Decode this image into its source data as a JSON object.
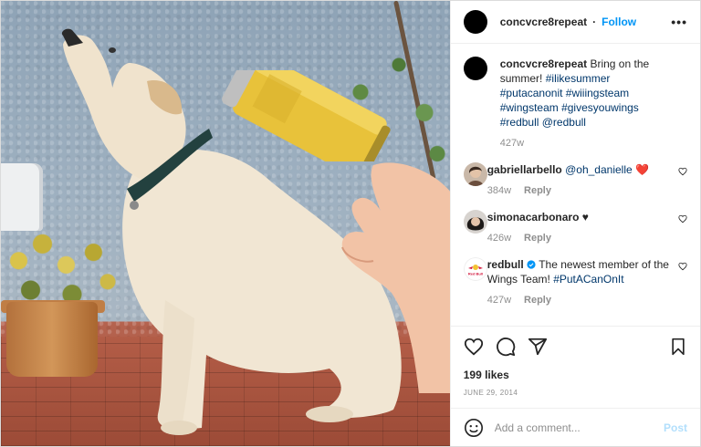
{
  "post": {
    "username": "concvcre8repeat",
    "follow_label": "Follow",
    "more_label": "•••",
    "caption": {
      "username": "concvcre8repeat",
      "text": "Bring on the summer!",
      "hashtags": "#ilikesummer #putacanonit #wiiingsteam #wingsteam #givesyouwings #redbull @redbull",
      "age": "427w"
    },
    "comments": [
      {
        "username": "gabriellarbello",
        "mention": "@oh_danielle",
        "emoji": "❤️",
        "age": "384w",
        "reply_label": "Reply"
      },
      {
        "username": "simonacarbonaro",
        "emoji": "♥",
        "age": "426w",
        "reply_label": "Reply"
      },
      {
        "username": "redbull",
        "verified": true,
        "text": "The newest member of the Wings Team!",
        "hashtag": "#PutACanOnIt",
        "age": "427w",
        "reply_label": "Reply",
        "avatar_text": "Red Bull"
      }
    ],
    "likes": "199 likes",
    "date": "JUNE 29, 2014",
    "add_comment_placeholder": "Add a comment...",
    "post_label": "Post"
  },
  "colors": {
    "accent": "#0095f6",
    "post_disabled": "#b2dffc",
    "muted": "#8e8e8e",
    "heart": "#ed4956"
  },
  "icons": [
    "heart-icon",
    "comment-icon",
    "share-icon",
    "bookmark-icon",
    "emoji-icon",
    "verified-icon",
    "more-icon"
  ]
}
